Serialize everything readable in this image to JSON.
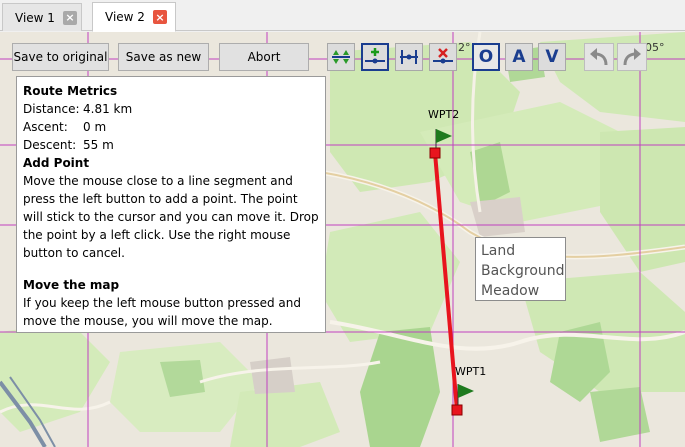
{
  "tabs": [
    {
      "label": "View 1",
      "close": "×"
    },
    {
      "label": "View 2",
      "close": "×"
    }
  ],
  "toolbar": {
    "save_original": "Save to original",
    "save_new": "Save as new",
    "abort": "Abort",
    "mode_o": "O",
    "mode_a": "A",
    "mode_v": "V"
  },
  "grid_labels": {
    "left": "2°",
    "right": "05°"
  },
  "help": {
    "metrics_title": "Route Metrics",
    "distance_label": "Distance:",
    "distance_value": "4.81 km",
    "ascent_label": "Ascent:",
    "ascent_value": "0 m",
    "descent_label": "Descent:",
    "descent_value": "55 m",
    "add_title": "Add Point",
    "add_text": "Move the mouse close to a line segment and press the left button to add a point. The point will stick to the cursor and you can move it. Drop the point by a left click. Use the right mouse button to cancel.",
    "move_title": "Move the map",
    "move_text": "If you keep the left mouse button pressed and move the mouse, you will move the map."
  },
  "waypoints": {
    "wpt2": "WPT2",
    "wpt1": "WPT1"
  },
  "tooltip": {
    "line1": "Land",
    "line2": "Background",
    "line3": "Meadow"
  },
  "colors": {
    "route": "#e8141e",
    "grid": "#c040c0",
    "flag": "#1e7a1e",
    "meadow": "#cde9b0",
    "forest": "#a6d58e"
  }
}
